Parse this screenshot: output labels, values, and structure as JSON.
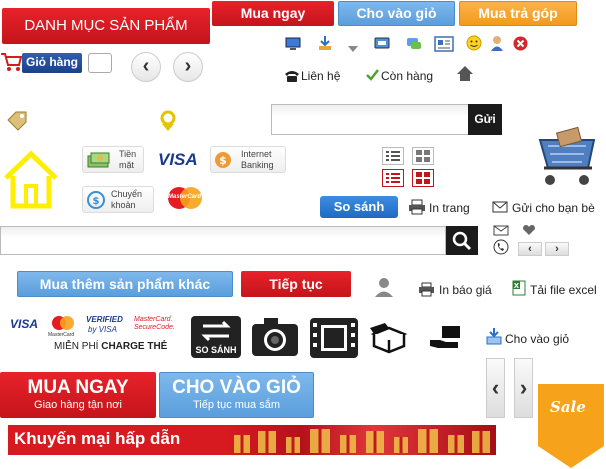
{
  "top_buttons": {
    "category": "DANH MỤC SẢN PHẨM",
    "buy_now": "Mua ngay",
    "add_to_cart": "Cho vào giỏ",
    "installment": "Mua trả góp"
  },
  "cart": {
    "label": "Giỏ hàng"
  },
  "contact": {
    "label": "Liên hệ",
    "in_stock": "Còn hàng"
  },
  "search": {
    "send_label": "Gửi"
  },
  "payment": {
    "cash_line1": "Tiền",
    "cash_line2": "mặt",
    "visa": "VISA",
    "internet_line1": "Internet",
    "internet_line2": "Banking",
    "transfer_line1": "Chuyển",
    "transfer_line2": "khoản",
    "mastercard": "MasterCard"
  },
  "actions": {
    "compare": "So sánh",
    "print": "In trang",
    "send_friend": "Gửi cho bạn bè",
    "buy_more": "Mua thêm sản phẩm khác",
    "continue": "Tiếp tục",
    "print_quote": "In báo giá",
    "download_excel": "Tải file excel",
    "add_to_cart_small": "Cho vào giỏ"
  },
  "cards_strip": {
    "visa": "VISA",
    "mastercard": "MasterCard",
    "verified_line1": "VERIFIED",
    "verified_line2": "by VISA",
    "securecode_line1": "MasterCard.",
    "securecode_line2": "SecureCode.",
    "free_charge_prefix": "MIỄN PHÍ",
    "free_charge_strong": "CHARGE THẺ",
    "compare_icon_label": "SO SÁNH"
  },
  "big_buttons": {
    "buy_now_title": "MUA NGAY",
    "buy_now_sub": "Giao hàng tận nơi",
    "cart_title": "CHO VÀO GIỎ",
    "cart_sub": "Tiếp tục mua sắm"
  },
  "promo": {
    "banner": "Khuyến mại hấp dẫn",
    "sale_tag": "Sale"
  },
  "colors": {
    "red": "#d71920",
    "blue": "#6aa9e4",
    "orange": "#f5a52b",
    "navy": "#1e4d92",
    "yellow": "#ffee00"
  }
}
